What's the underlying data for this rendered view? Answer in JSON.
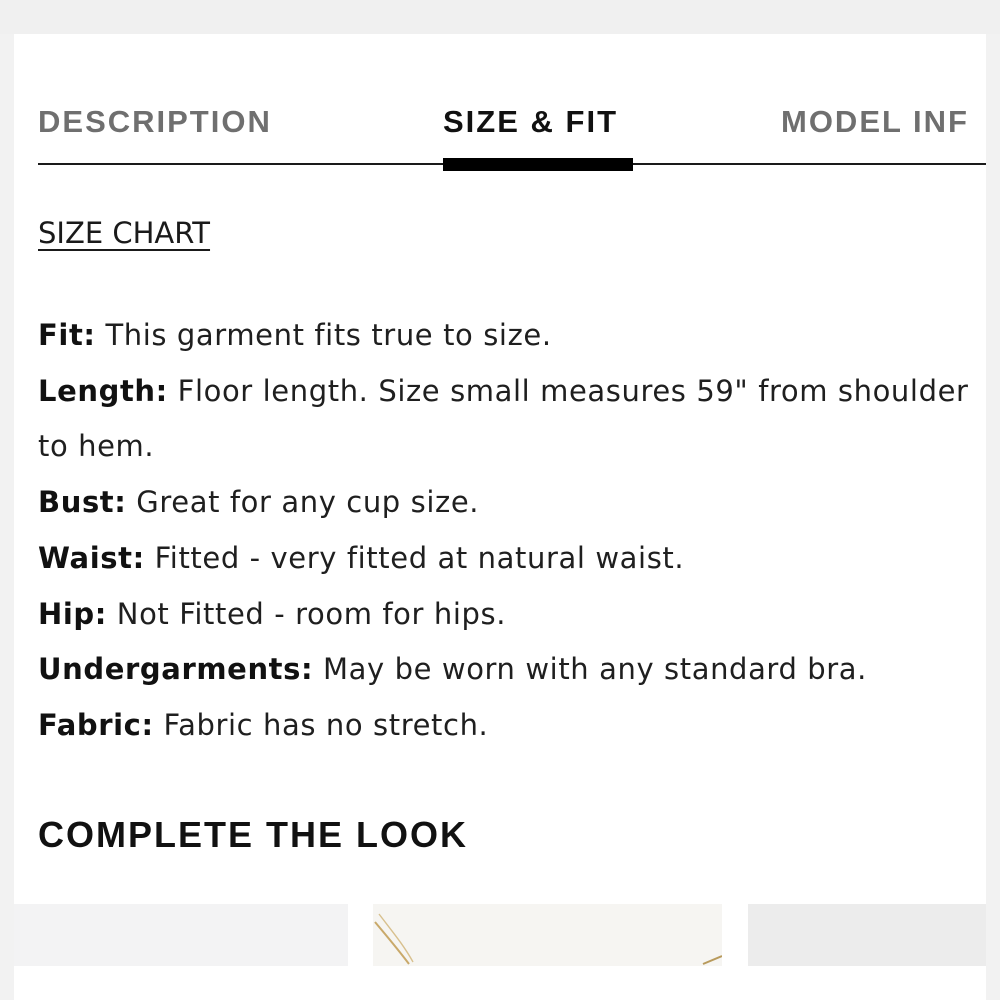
{
  "tabs": [
    {
      "label": "DESCRIPTION",
      "active": false
    },
    {
      "label": "SIZE & FIT",
      "active": true
    },
    {
      "label": "MODEL INF",
      "active": false
    }
  ],
  "size_chart": {
    "label": "SIZE CHART"
  },
  "details": [
    {
      "label": "Fit:",
      "text": " This garment fits true to size."
    },
    {
      "label": "Length:",
      "text": " Floor length. Size small measures 59\" from shoulder to hem."
    },
    {
      "label": "Bust:",
      "text": " Great for any cup size."
    },
    {
      "label": "Waist:",
      "text": " Fitted - very fitted at natural waist."
    },
    {
      "label": "Hip:",
      "text": " Not Fitted - room for hips."
    },
    {
      "label": "Undergarments:",
      "text": " May be worn with any standard bra."
    },
    {
      "label": "Fabric:",
      "text": " Fabric has no stretch."
    }
  ],
  "complete_the_look": {
    "heading": "COMPLETE THE LOOK"
  },
  "colors": {
    "active_tab": "#111111",
    "inactive_tab": "#6f6f6f",
    "page_background": "#ffffff",
    "outer_background": "#f0f0f0"
  }
}
